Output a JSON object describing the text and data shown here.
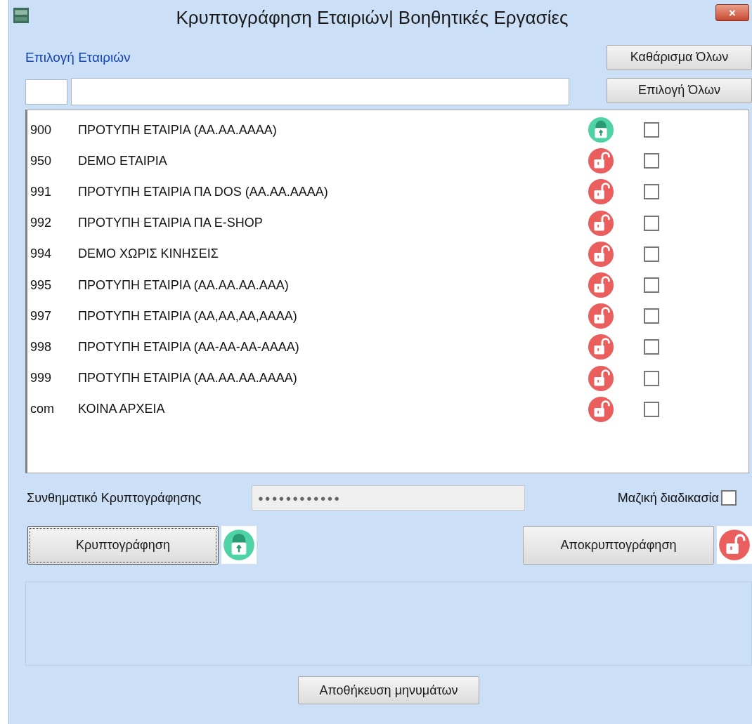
{
  "window": {
    "title": "Κρυπτογράφηση Εταιριών| Βοηθητικές Εργασίες",
    "close_label": "×"
  },
  "selection": {
    "label": "Επιλογή Εταιριών",
    "clear_all": "Καθάρισμα Όλων",
    "select_all": "Επιλογή Όλων"
  },
  "companies": [
    {
      "code": "900",
      "name": "ΠΡΟΤΥΠΗ  ΕΤΑΙΡΙΑ (ΑΑ.ΑΑ.ΑΑΑΑ)",
      "encrypted": true,
      "checked": false
    },
    {
      "code": "950",
      "name": "DEMO ΕΤΑΙΡΙΑ",
      "encrypted": false,
      "checked": false
    },
    {
      "code": "991",
      "name": "ΠΡΟΤΥΠΗ ΕΤΑΙΡΙΑ ΠΑ DOS (ΑΑ.ΑΑ.ΑΑΑΑ)",
      "encrypted": false,
      "checked": false
    },
    {
      "code": "992",
      "name": "ΠΡΟΤΥΠΗ ΕΤΑΙΡΙΑ ΠΑ E-SHOP",
      "encrypted": false,
      "checked": false
    },
    {
      "code": "994",
      "name": "DEMO ΧΩΡΙΣ ΚΙΝΗΣΕΙΣ",
      "encrypted": false,
      "checked": false
    },
    {
      "code": "995",
      "name": "ΠΡΟΤΥΠΗ ΕΤΑΙΡΙΑ (ΑΑ.ΑΑ.ΑΑ.ΑΑΑ)",
      "encrypted": false,
      "checked": false
    },
    {
      "code": "997",
      "name": "ΠΡΟΤΥΠΗ ΕΤΑΙΡΙΑ (ΑΑ,ΑΑ,ΑΑ,ΑΑΑΑ)",
      "encrypted": false,
      "checked": false
    },
    {
      "code": "998",
      "name": "ΠΡΟΤΥΠΗ ΕΤΑΙΡΙΑ (ΑΑ-ΑΑ-ΑΑ-ΑΑΑΑ)",
      "encrypted": false,
      "checked": false
    },
    {
      "code": "999",
      "name": "ΠΡΟΤΥΠΗ ΕΤΑΙΡΙΑ (ΑΑ.ΑΑ.ΑΑ.ΑΑΑΑ)",
      "encrypted": false,
      "checked": false
    },
    {
      "code": "com",
      "name": "ΚΟΙΝΑ ΑΡΧΕΙΑ",
      "encrypted": false,
      "checked": false
    }
  ],
  "password": {
    "label": "Συνθηματικό Κρυπτογράφησης",
    "value": "●●●●●●●●●●●●"
  },
  "batch": {
    "label": "Μαζική διαδικασία",
    "checked": false
  },
  "encrypt_button": "Κρυπτογράφηση",
  "decrypt_button": "Αποκρυπτογράφηση",
  "save_messages_button": "Αποθήκευση μηνυμάτων"
}
